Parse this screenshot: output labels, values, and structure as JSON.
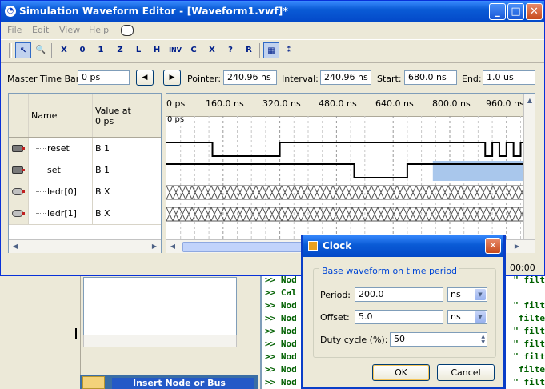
{
  "window": {
    "title": "Simulation Waveform Editor - [Waveform1.vwf]*",
    "controls": [
      "minimize",
      "maximize",
      "close"
    ]
  },
  "menu": [
    "File",
    "Edit",
    "View",
    "Help"
  ],
  "toolbar": {
    "icons": [
      "pointer-tool",
      "zoom-tool",
      "uninitialized-tool",
      "forcing-low-tool",
      "forcing-high-tool",
      "high-impedance-tool",
      "weak-low-tool",
      "weak-high-tool",
      "invert-tool",
      "count-value-tool",
      "overwrite-clock-tool",
      "arbitrary-value-tool",
      "random-value-tool",
      "overwrite-value-tool",
      "snap-to-grid-tool",
      "sort-tool"
    ],
    "labels": [
      "X",
      "0",
      "1",
      "Z",
      "L",
      "H",
      "INV",
      "C",
      "X",
      "?",
      "R"
    ]
  },
  "timebar": {
    "master_label": "Master Time Bar:",
    "master_value": "0 ps",
    "pointer_label": "Pointer:",
    "pointer_value": "240.96 ns",
    "interval_label": "Interval:",
    "interval_value": "240.96 ns",
    "start_label": "Start:",
    "start_value": "680.0 ns",
    "end_label": "End:",
    "end_value": "1.0 us"
  },
  "nodes": {
    "header_name": "Name",
    "header_value_line1": "Value at",
    "header_value_line2": "0 ps",
    "rows": [
      {
        "name": "reset",
        "value": "B 1",
        "kind": "input"
      },
      {
        "name": "set",
        "value": "B 1",
        "kind": "input"
      },
      {
        "name": "ledr[0]",
        "value": "B X",
        "kind": "output"
      },
      {
        "name": "ledr[1]",
        "value": "B X",
        "kind": "output"
      }
    ]
  },
  "ruler": {
    "ticks": [
      "0 ps",
      "160.0 ns",
      "320.0 ns",
      "480.0 ns",
      "640.0 ns",
      "800.0 ns",
      "960.0 ns"
    ],
    "cursor_label": "0 ps",
    "overflow_label": "00:00"
  },
  "waveforms": {
    "reset": {
      "levels": [
        [
          0,
          1
        ],
        [
          130,
          0
        ],
        [
          320,
          1
        ],
        [
          880,
          "clock"
        ]
      ]
    },
    "set": {
      "levels": [
        [
          0,
          1
        ],
        [
          530,
          0
        ],
        [
          680,
          1
        ]
      ],
      "selected_from": 1090
    },
    "ledr0": "undefined",
    "ledr1": "undefined"
  },
  "dialog": {
    "title": "Clock",
    "group_label": "Base waveform on time period",
    "period_label": "Period:",
    "period_value": "200.0",
    "period_unit": "ns",
    "offset_label": "Offset:",
    "offset_value": "5.0",
    "offset_unit": "ns",
    "duty_label": "Duty cycle (%):",
    "duty_value": "50",
    "ok_label": "OK",
    "cancel_label": "Cancel"
  },
  "console": {
    "left": [
      ">> Nod",
      ">> Cal",
      ">> Nod",
      ">> Nod",
      ">> Nod",
      ">> Nod",
      ">> Nod",
      ">> Nod",
      ">> Nod"
    ],
    "right": [
      "\" filt",
      "",
      "\" filt",
      " filte",
      "\" filt",
      "\" filt",
      "\" filt",
      " filte",
      "\" filt"
    ]
  },
  "background": {
    "task_label": "Insert Node or Bus"
  },
  "colors": {
    "titlebar": "#0a5bd6",
    "console_text": "#006000",
    "selection": "#a9c7ec"
  }
}
